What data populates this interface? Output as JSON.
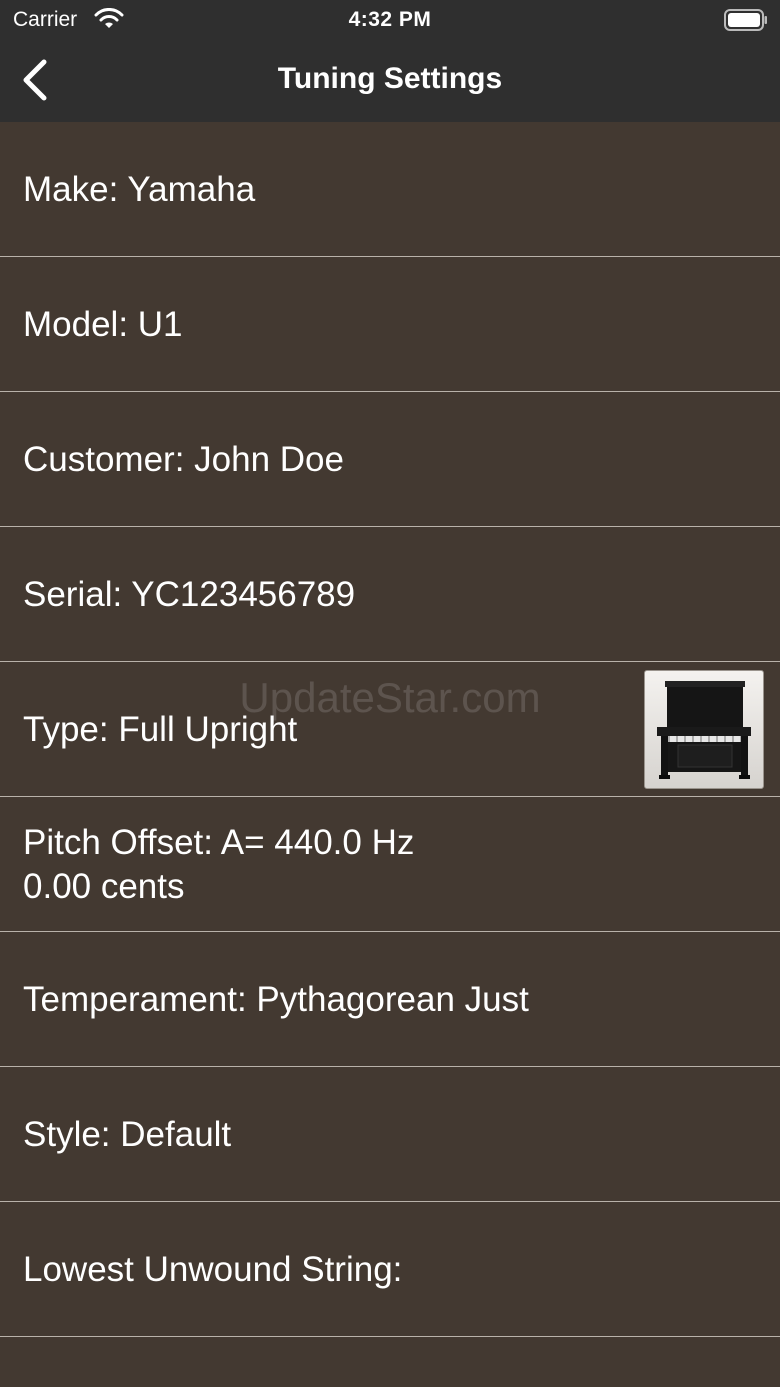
{
  "status_bar": {
    "carrier": "Carrier",
    "time": "4:32 PM"
  },
  "nav": {
    "title": "Tuning Settings",
    "back_icon": "chevron-left-icon"
  },
  "rows": [
    {
      "label": "Make: Yamaha"
    },
    {
      "label": "Model: U1"
    },
    {
      "label": "Customer: John Doe"
    },
    {
      "label": "Serial: YC123456789"
    },
    {
      "label": "Type: Full Upright",
      "icon": "upright-piano-icon"
    },
    {
      "label": "Pitch Offset: A= 440.0 Hz\n0.00 cents"
    },
    {
      "label": "Temperament: Pythagorean Just"
    },
    {
      "label": "Style: Default"
    },
    {
      "label": "Lowest Unwound String:"
    }
  ],
  "watermark": "UpdateStar.com",
  "colors": {
    "bar_background": "#2f2f2f",
    "list_background": "#433931",
    "separator": "#b9b2aa"
  }
}
